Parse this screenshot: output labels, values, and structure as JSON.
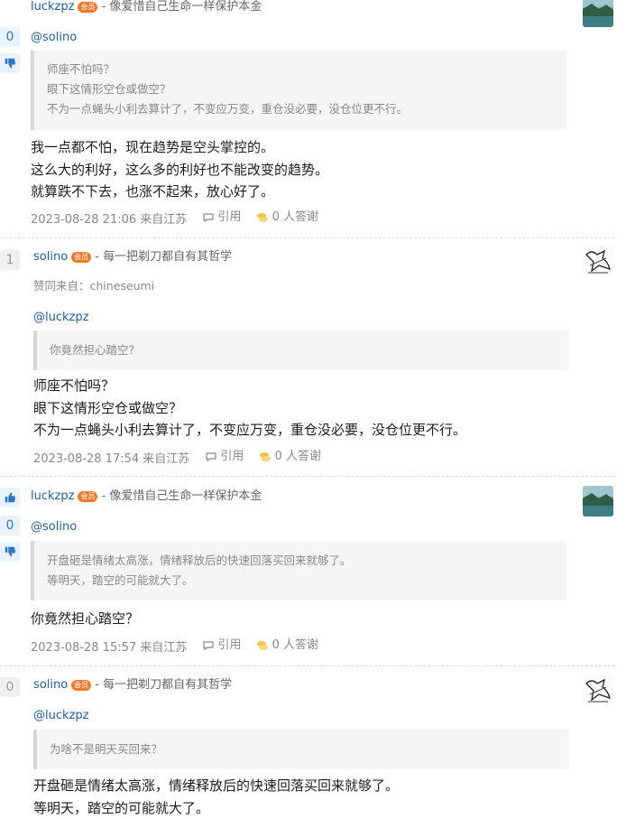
{
  "posts": [
    {
      "username": "luckzpz",
      "badge": "会员",
      "signature": "- 像爱惜自己生命一样保护本金",
      "vote_count": "0",
      "mention": "@solino",
      "quote": [
        "师座不怕吗？",
        "眼下这情形空仓或做空？",
        "不为一点蝇头小利去算计了，不变应万变，重仓没必要，没仓位更不行。"
      ],
      "body": [
        "我一点都不怕，现在趋势是空头掌控的。",
        "这么大的利好，这么多的利好也不能改变的趋势。",
        "就算跌不下去，也涨不起来，放心好了。"
      ],
      "timestamp": "2023-08-28 21:06 来自江苏",
      "quote_label": "引用",
      "thanks_label": "0 人答谢"
    },
    {
      "username": "solino",
      "badge": "会员",
      "signature": "- 每一把剃刀都自有其哲学",
      "vote_count": "1",
      "endorsed": "赞同来自：chineseumi",
      "mention": "@luckzpz",
      "quote": [
        "你竟然担心踏空？"
      ],
      "body": [
        "师座不怕吗？",
        "眼下这情形空仓或做空？",
        "不为一点蝇头小利去算计了，不变应万变，重仓没必要，没仓位更不行。"
      ],
      "timestamp": "2023-08-28 17:54 来自江苏",
      "quote_label": "引用",
      "thanks_label": "0 人答谢"
    },
    {
      "username": "luckzpz",
      "badge": "会员",
      "signature": "- 像爱惜自己生命一样保护本金",
      "vote_count": "0",
      "mention": "@solino",
      "quote": [
        "开盘砸是情绪太高涨，情绪释放后的快速回落买回来就够了。",
        "等明天，踏空的可能就大了。"
      ],
      "body": [
        "你竟然担心踏空？"
      ],
      "timestamp": "2023-08-28 15:57 来自江苏",
      "quote_label": "引用",
      "thanks_label": "0 人答谢"
    },
    {
      "username": "solino",
      "badge": "会员",
      "signature": "- 每一把剃刀都自有其哲学",
      "vote_count": "0",
      "mention": "@luckzpz",
      "quote": [
        "为啥不是明天买回来？"
      ],
      "body": [
        "开盘砸是情绪太高涨，情绪释放后的快速回落买回来就够了。",
        "等明天，踏空的可能就大了。"
      ]
    }
  ],
  "colors": {
    "link": "#1f5fa8",
    "vote_bg": "#eaf3fd",
    "badge": "#f07a2a"
  },
  "icons": [
    "thumbs-up-icon",
    "thumbs-down-icon",
    "comment-icon",
    "coins-icon"
  ]
}
